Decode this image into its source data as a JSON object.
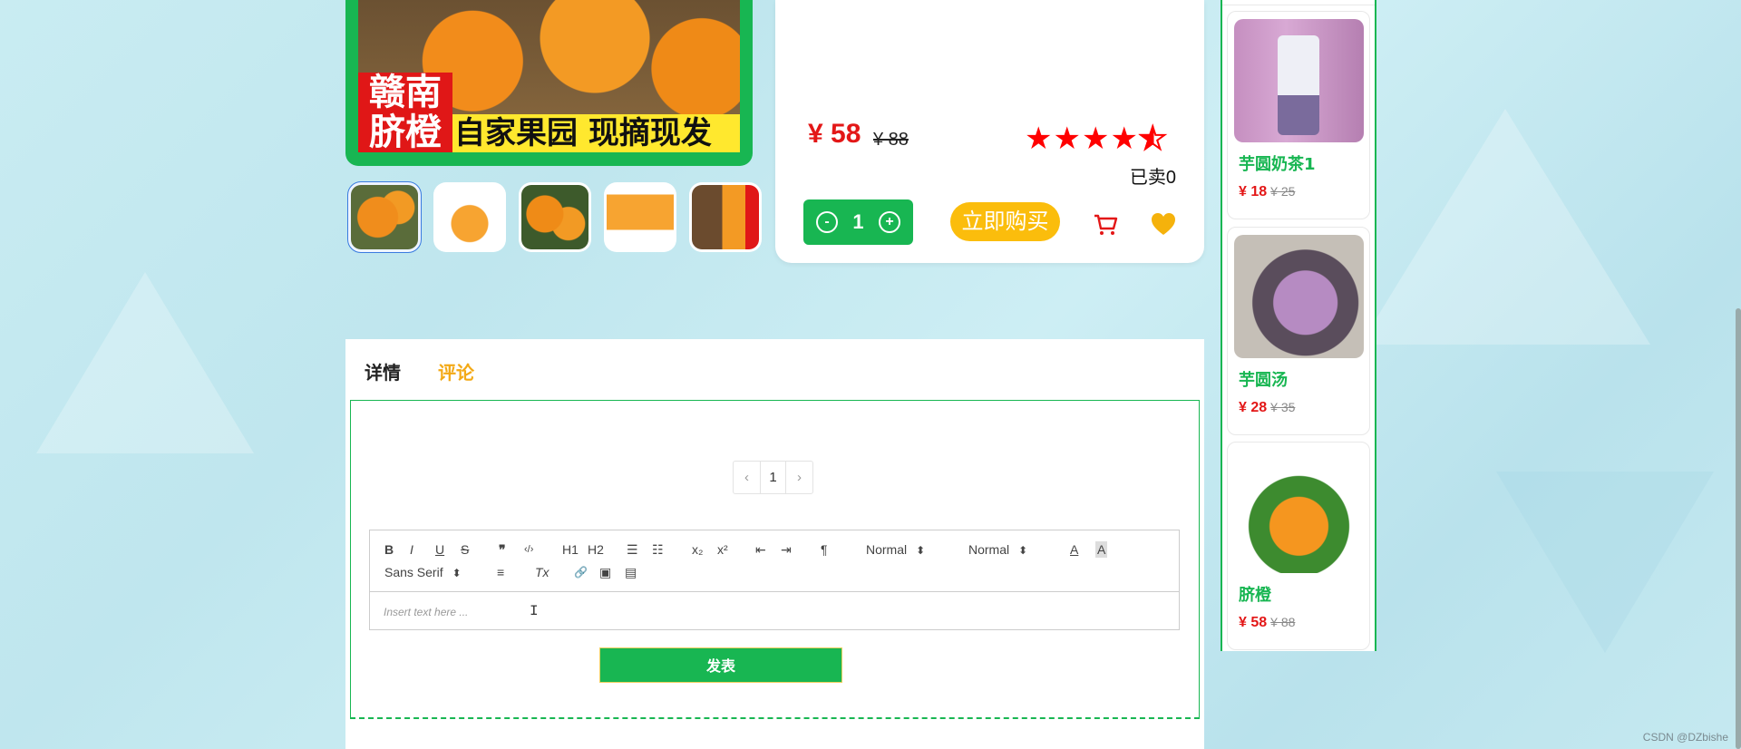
{
  "product": {
    "image_label_red": "赣南\n脐橙",
    "image_banner": "自家果园 现摘现发",
    "thumbnails": [
      "t1",
      "t2",
      "t3",
      "t4",
      "t5"
    ],
    "price": "¥ 58",
    "old_price": "¥ 88",
    "rating": 4.5,
    "sold": "已卖0",
    "quantity": "1",
    "minus_label": "-",
    "plus_label": "+",
    "buy_label": "立即购买",
    "cart_icon": "cart-icon",
    "favorite_icon": "heart-icon",
    "colors": {
      "accent": "#18b652",
      "price": "#e31717",
      "buy": "#fbbd0c",
      "tab_active": "#f3a915"
    }
  },
  "sidebar": {
    "items": [
      {
        "name": "芋圆奶茶1",
        "price": "¥ 18",
        "old_price": "¥ 25"
      },
      {
        "name": "芋圆汤",
        "price": "¥ 28",
        "old_price": "¥ 35"
      },
      {
        "name": "脐橙",
        "price": "¥ 58",
        "old_price": "¥ 88"
      }
    ]
  },
  "tabs": {
    "detail": "详情",
    "comment": "评论"
  },
  "pager": {
    "prev": "‹",
    "current": "1",
    "next": "›"
  },
  "editor": {
    "toolbar": {
      "bold": "B",
      "italic": "I",
      "underline": "U",
      "strike": "S",
      "quote": "❞",
      "code": "‹/›",
      "h1": "H1",
      "h2": "H2",
      "ordered_list": "☰",
      "bullet_list": "☷",
      "subscript": "x₂",
      "superscript": "x²",
      "outdent": "⇤",
      "indent": "⇥",
      "direction": "¶",
      "size_select": "Normal",
      "header_select": "Normal",
      "font_color": "A",
      "background_color": "A",
      "font_select": "Sans Serif",
      "align": "≡",
      "clean": "Tx",
      "link": "🔗",
      "image": "▣",
      "video": "▤"
    },
    "placeholder": "Insert text here ...",
    "submit_label": "发表"
  },
  "watermark": "CSDN @DZbishe"
}
